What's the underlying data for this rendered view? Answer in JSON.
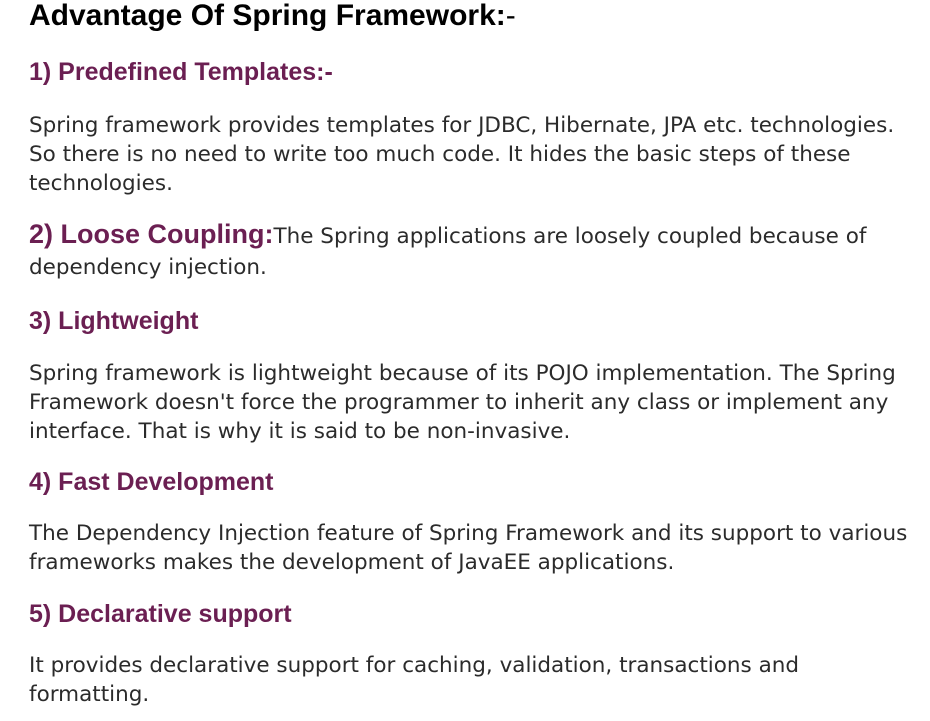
{
  "title": {
    "main": "Advantage Of Spring Framework:",
    "suffix": "-"
  },
  "sections": [
    {
      "heading": "1) Predefined Templates:-",
      "text": "Spring framework provides templates for JDBC, Hibernate, JPA etc. technologies. So there is no need to write too much code. It hides the basic steps of these technologies."
    },
    {
      "heading": "2) Loose Coupling:",
      "text": "The Spring applications are loosely coupled because of dependency injection."
    },
    {
      "heading": "3) Lightweight",
      "text": "Spring framework is lightweight because of its POJO implementation. The Spring Framework doesn't force the programmer to inherit any class or implement any interface. That is why it is said to be non-invasive."
    },
    {
      "heading": "4) Fast Development",
      "text": "The Dependency Injection feature of Spring Framework and its support to various frameworks makes the development of JavaEE applications."
    },
    {
      "heading": "5) Declarative support",
      "text": "It provides declarative support for caching, validation, transactions and formatting."
    }
  ],
  "colors": {
    "heading": "#6b1f52",
    "title": "#000000",
    "text": "#2b2b2b",
    "background": "#ffffff"
  }
}
